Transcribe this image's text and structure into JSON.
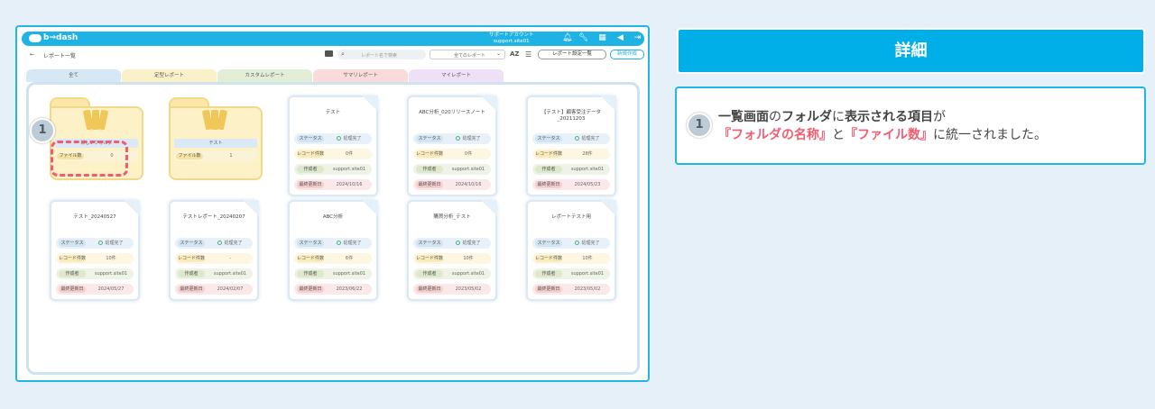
{
  "app": {
    "logo": "b→dash",
    "account_label": "サポートアカウント",
    "account_user": "support.site01"
  },
  "toolbar": {
    "back": "←",
    "title": "レポート一覧",
    "search_placeholder": "レポート名で検索",
    "filter_value": "全てのレポート",
    "az": "AZ",
    "settings_button": "レポート設定一覧",
    "new_button": "新規作成"
  },
  "tabs": [
    {
      "label": "全て",
      "color": "#d6e8f5"
    },
    {
      "label": "定型レポート",
      "color": "#fbf0c8"
    },
    {
      "label": "カスタムレポート",
      "color": "#e3eed6"
    },
    {
      "label": "サマリレポート",
      "color": "#fbdada"
    },
    {
      "label": "マイレポート",
      "color": "#f0e0f7"
    }
  ],
  "folders": [
    {
      "name": "新しいフォルダ",
      "count_label": "ファイル数",
      "count": "0"
    },
    {
      "name": "テスト",
      "count_label": "ファイル数",
      "count": "1"
    }
  ],
  "row_labels": [
    "ステータス",
    "レコード件数",
    "作成者",
    "最終更新日"
  ],
  "reports": [
    {
      "name": "テスト",
      "status": "処理完了",
      "records": "0件",
      "author": "support.site01",
      "updated": "2024/10/16"
    },
    {
      "name": "ABC分析_020リリースノート",
      "status": "処理完了",
      "records": "0件",
      "author": "support.site01",
      "updated": "2024/10/16"
    },
    {
      "name": "【テスト】顧客受注データ_20211203",
      "status": "処理完了",
      "records": "28件",
      "author": "support.site01",
      "updated": "2024/05/23"
    },
    {
      "name": "テスト_20240527",
      "status": "処理完了",
      "records": "10件",
      "author": "support.site01",
      "updated": "2024/05/27"
    },
    {
      "name": "テストレポート_20240207",
      "status": "処理完了",
      "records": "-",
      "author": "support.site01",
      "updated": "2024/02/07"
    },
    {
      "name": "ABC分析",
      "status": "処理完了",
      "records": "6件",
      "author": "support.site01",
      "updated": "2023/06/22"
    },
    {
      "name": "購買分析_テスト",
      "status": "処理完了",
      "records": "10件",
      "author": "support.site01",
      "updated": "2023/05/02"
    },
    {
      "name": "レポートテスト用",
      "status": "処理完了",
      "records": "10件",
      "author": "support.site01",
      "updated": "2023/05/02"
    }
  ],
  "badge": "1",
  "detail": {
    "title": "詳細",
    "badge": "1",
    "line1_a": "一覧画面",
    "line1_b": "の",
    "line1_c": "フォルダ",
    "line1_d": "に",
    "line1_e": "表示される項目",
    "line1_f": "が",
    "line2_a": "『フォルダの名称』",
    "line2_b": "と",
    "line2_c": "『ファイル数』",
    "line2_d": "に統一されました。"
  }
}
